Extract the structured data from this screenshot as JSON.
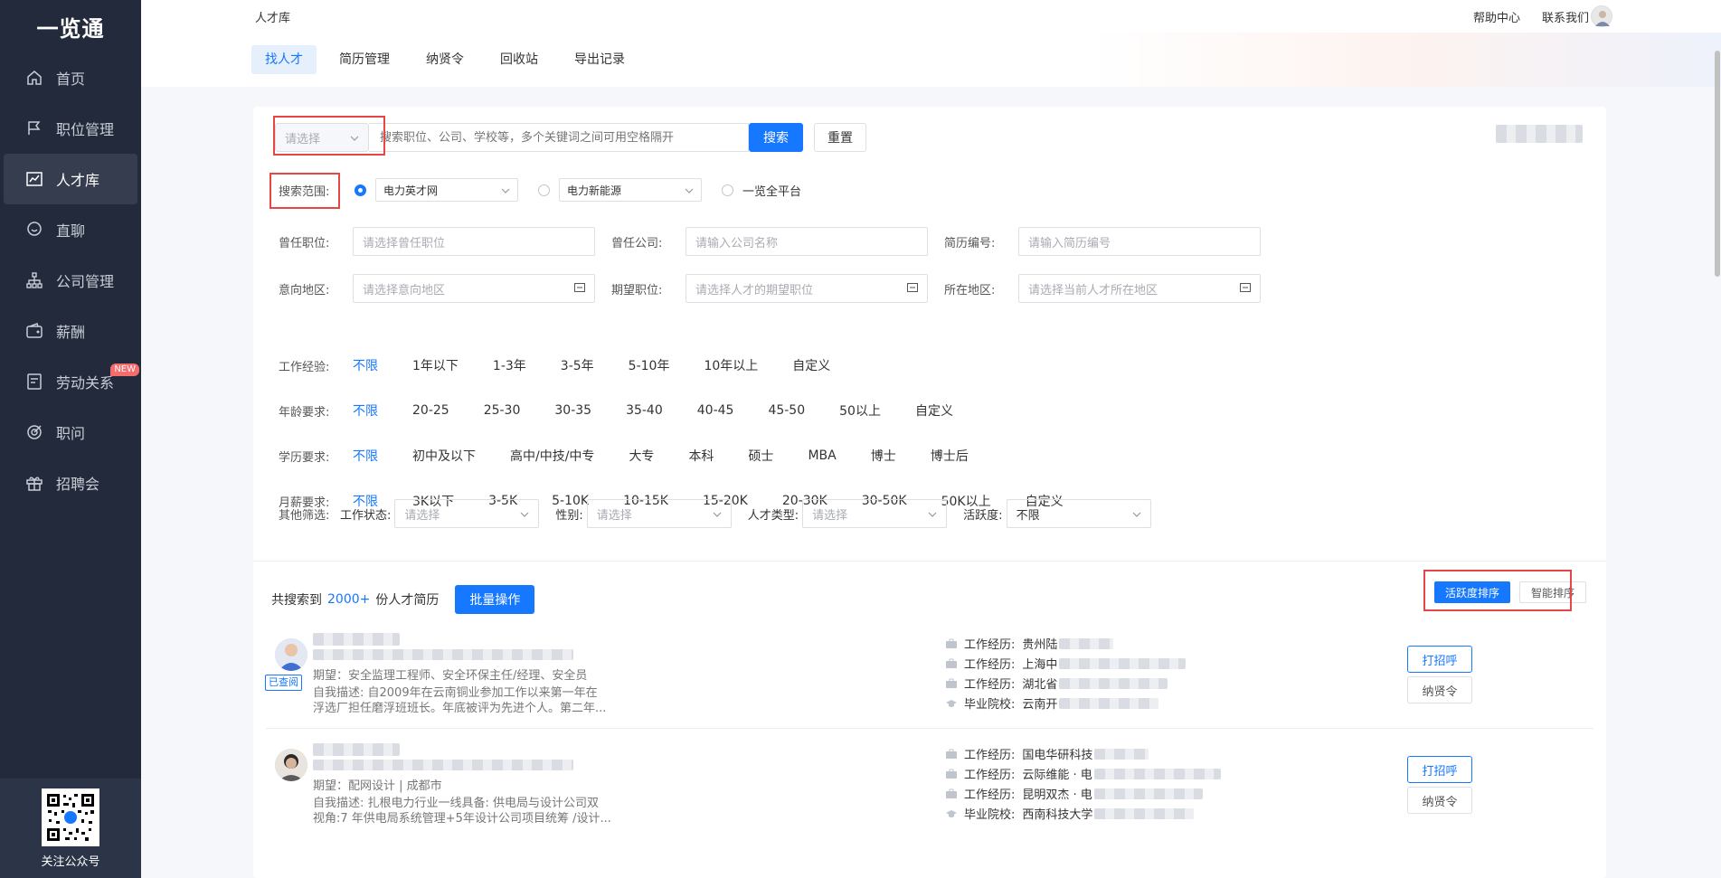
{
  "brand": "一览通",
  "sidebar": {
    "items": [
      {
        "label": "首页",
        "icon": "home-icon"
      },
      {
        "label": "职位管理",
        "icon": "flag-icon"
      },
      {
        "label": "人才库",
        "icon": "chart-icon",
        "active": true
      },
      {
        "label": "直聊",
        "icon": "chat-icon"
      },
      {
        "label": "公司管理",
        "icon": "org-icon"
      },
      {
        "label": "薪酬",
        "icon": "wallet-icon"
      },
      {
        "label": "劳动关系",
        "icon": "contract-icon",
        "badge": "NEW"
      },
      {
        "label": "职问",
        "icon": "target-icon"
      },
      {
        "label": "招聘会",
        "icon": "gift-icon"
      }
    ],
    "qr_label": "关注公众号"
  },
  "topbar": {
    "title": "人才库",
    "help": "帮助中心",
    "contact": "联系我们"
  },
  "tabs": [
    "找人才",
    "简历管理",
    "纳贤令",
    "回收站",
    "导出记录"
  ],
  "search": {
    "select_placeholder": "请选择",
    "keyword_placeholder": "搜索职位、公司、学校等，多个关键词之间可用空格隔开",
    "search_btn": "搜索",
    "reset_btn": "重置"
  },
  "scope": {
    "label": "搜索范围:",
    "options": [
      {
        "label": "电力英才网",
        "checked": true,
        "has_select": true
      },
      {
        "label": "电力新能源",
        "checked": false,
        "has_select": true
      },
      {
        "label": "一览全平台",
        "checked": false,
        "has_select": false
      }
    ]
  },
  "fields_row1": [
    {
      "label": "曾任职位:",
      "placeholder": "请选择曾任职位"
    },
    {
      "label": "曾任公司:",
      "placeholder": "请输入公司名称"
    },
    {
      "label": "简历编号:",
      "placeholder": "请输入简历编号"
    }
  ],
  "fields_row2": [
    {
      "label": "意向地区:",
      "placeholder": "请选择意向地区"
    },
    {
      "label": "期望职位:",
      "placeholder": "请选择人才的期望职位"
    },
    {
      "label": "所在地区:",
      "placeholder": "请选择当前人才所在地区"
    }
  ],
  "filters": [
    {
      "label": "工作经验:",
      "options": [
        "不限",
        "1年以下",
        "1-3年",
        "3-5年",
        "5-10年",
        "10年以上",
        "自定义"
      ]
    },
    {
      "label": "年龄要求:",
      "options": [
        "不限",
        "20-25",
        "25-30",
        "30-35",
        "35-40",
        "40-45",
        "45-50",
        "50以上",
        "自定义"
      ]
    },
    {
      "label": "学历要求:",
      "options": [
        "不限",
        "初中及以下",
        "高中/中技/中专",
        "大专",
        "本科",
        "硕士",
        "MBA",
        "博士",
        "博士后"
      ]
    },
    {
      "label": "月薪要求:",
      "options": [
        "不限",
        "3K以下",
        "3-5K",
        "5-10K",
        "10-15K",
        "15-20K",
        "20-30K",
        "30-50K",
        "50K以上",
        "自定义"
      ]
    }
  ],
  "other": {
    "label": "其他筛选:",
    "items": [
      {
        "label": "工作状态:",
        "value": "请选择"
      },
      {
        "label": "性别:",
        "value": "请选择"
      },
      {
        "label": "人才类型:",
        "value": "请选择"
      },
      {
        "label": "活跃度:",
        "value": "不限"
      }
    ]
  },
  "results": {
    "prefix": "共搜索到",
    "count": "2000+",
    "suffix": "份人才简历",
    "batch_btn": "批量操作",
    "sort_active": "活跃度排序",
    "sort_smart": "智能排序"
  },
  "cards": [
    {
      "seen": "已查阅",
      "expect": "期望：安全监理工程师、安全环保主任/经理、安全员",
      "desc1": "自我描述:  自2009年在云南铜业参加工作以来第一年在",
      "desc2": "浮选厂担任磨浮班班长。年底被评为先进个人。第二年...",
      "exp": [
        {
          "k": "工作经历:",
          "v": "贵州陆"
        },
        {
          "k": "工作经历:",
          "v": "上海中"
        },
        {
          "k": "工作经历:",
          "v": "湖北省"
        },
        {
          "k": "毕业院校:",
          "v": "云南开"
        }
      ],
      "btn_call": "打招呼",
      "btn_invite": "纳贤令"
    },
    {
      "seen": "",
      "expect": "期望：配网设计 | 成都市",
      "desc1": "自我描述:  扎根电力行业一线具备: 供电局与设计公司双",
      "desc2": "视角:7 年供电局系统管理+5年设计公司项目统筹 /设计...",
      "exp": [
        {
          "k": "工作经历:",
          "v": "国电华研科技"
        },
        {
          "k": "工作经历:",
          "v": "云际维能 · 电"
        },
        {
          "k": "工作经历:",
          "v": "昆明双杰 · 电"
        },
        {
          "k": "毕业院校:",
          "v": "西南科技大学"
        }
      ],
      "btn_call": "打招呼",
      "btn_invite": "纳贤令"
    }
  ]
}
